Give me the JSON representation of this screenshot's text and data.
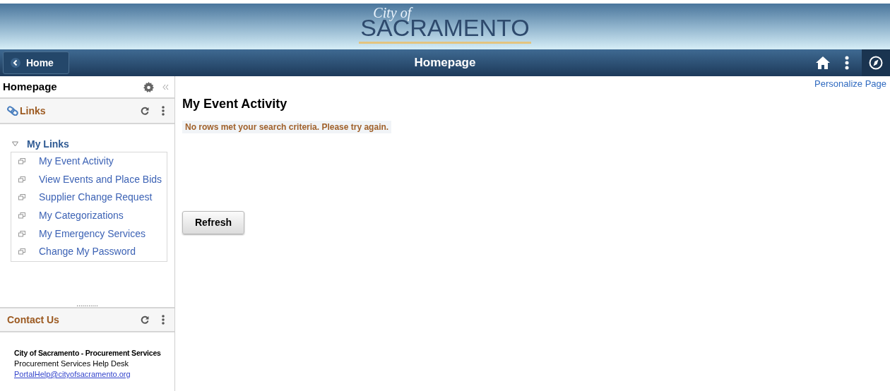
{
  "banner": {
    "logo_small": "City of",
    "logo_large": "SACRAMENTO"
  },
  "nav_bar": {
    "back_button": "Home",
    "title": "Homepage"
  },
  "sidebar": {
    "title": "Homepage",
    "links_pod": {
      "title": "Links",
      "group": {
        "label": "My Links",
        "expanded": true,
        "items": [
          "My Event Activity",
          "View Events and Place Bids",
          "Supplier Change Request",
          "My Categorizations",
          "My Emergency Services",
          "Change My Password"
        ]
      }
    },
    "splitter": "...........",
    "contact_pod": {
      "title": "Contact Us",
      "org": "City of Sacramento - Procurement Services",
      "desk": "Procurement Services Help Desk",
      "email": "PortalHelp@cityofsacramento.org"
    }
  },
  "main": {
    "personalize_link": "Personalize Page",
    "heading": "My Event Activity",
    "message": "No rows met your search criteria. Please try again.",
    "button": "Refresh"
  }
}
